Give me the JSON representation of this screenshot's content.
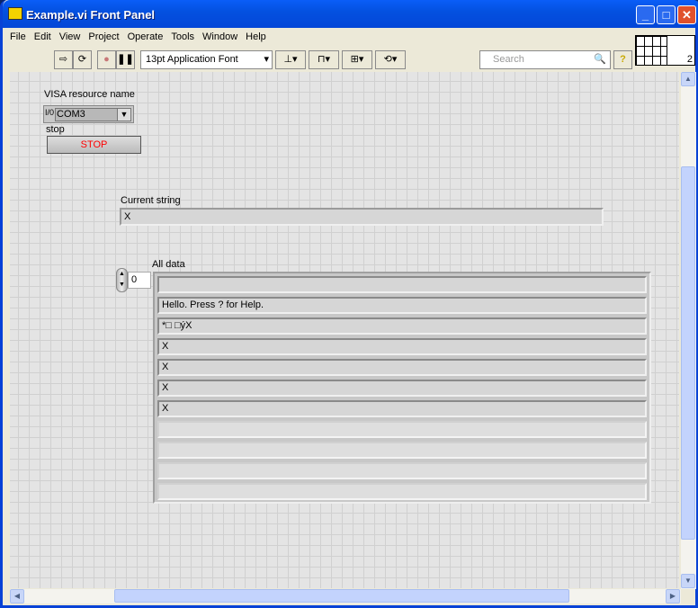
{
  "window": {
    "title": "Example.vi Front Panel"
  },
  "menu": [
    "File",
    "Edit",
    "View",
    "Project",
    "Operate",
    "Tools",
    "Window",
    "Help"
  ],
  "toolbar": {
    "font": "13pt Application Font",
    "search_placeholder": "Search",
    "help": "?",
    "connector_count": "2"
  },
  "panel": {
    "visa": {
      "label": "VISA resource name",
      "value": "COM3",
      "prefix": "I/0"
    },
    "stop": {
      "label": "stop",
      "text": "STOP",
      "text_color": "#ff0000"
    },
    "current_string": {
      "label": "Current string",
      "value": "X"
    },
    "all_data": {
      "label": "All data",
      "index": "0",
      "elements": [
        "",
        "Hello. Press ? for Help.",
        "*□ □ýX",
        "X",
        "X",
        "X",
        "X",
        "",
        "",
        "",
        ""
      ]
    }
  }
}
